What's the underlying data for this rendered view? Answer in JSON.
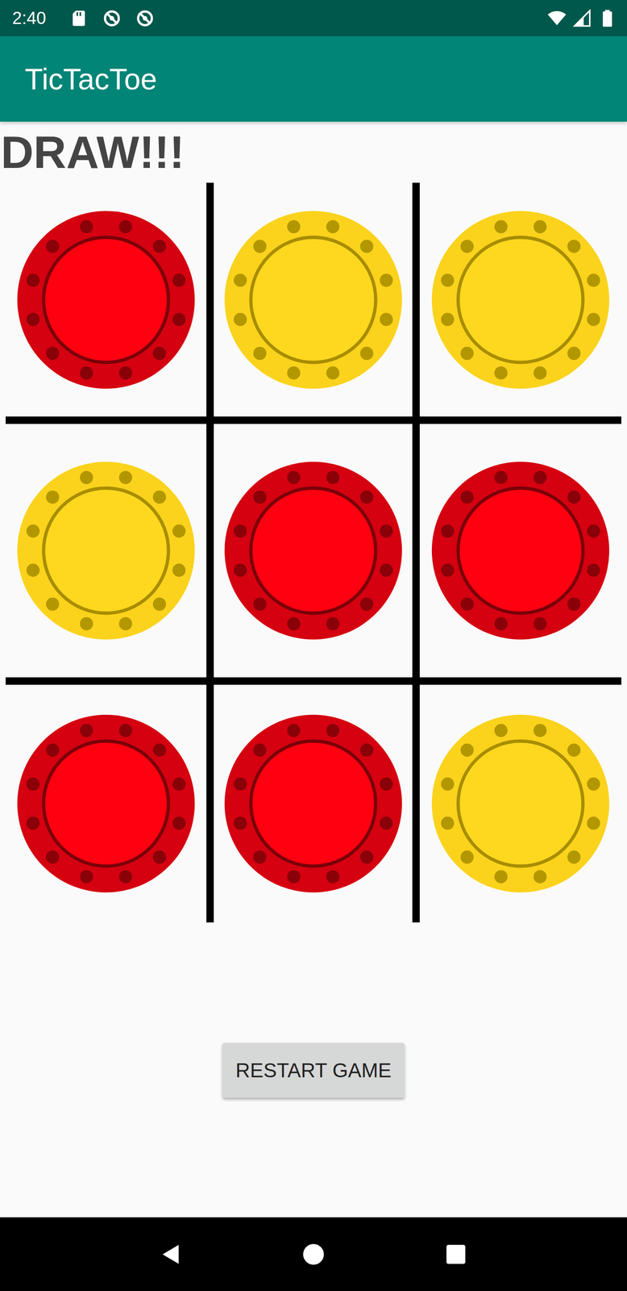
{
  "status_bar": {
    "time": "2:40"
  },
  "window": {
    "title": "TicTacToe"
  },
  "message": "DRAW!!!",
  "board": [
    {
      "kind": "red",
      "color": "#ff0010"
    },
    {
      "kind": "yellow",
      "color": "#fdd81f"
    },
    {
      "kind": "yellow",
      "color": "#fdd81f"
    },
    {
      "kind": "yellow",
      "color": "#fdd81f"
    },
    {
      "kind": "red",
      "color": "#ff0010"
    },
    {
      "kind": "red",
      "color": "#ff0010"
    },
    {
      "kind": "red",
      "color": "#ff0010"
    },
    {
      "kind": "red",
      "color": "#ff0010"
    },
    {
      "kind": "yellow",
      "color": "#fdd81f"
    }
  ],
  "buttons": [
    "RESTART GAME"
  ]
}
